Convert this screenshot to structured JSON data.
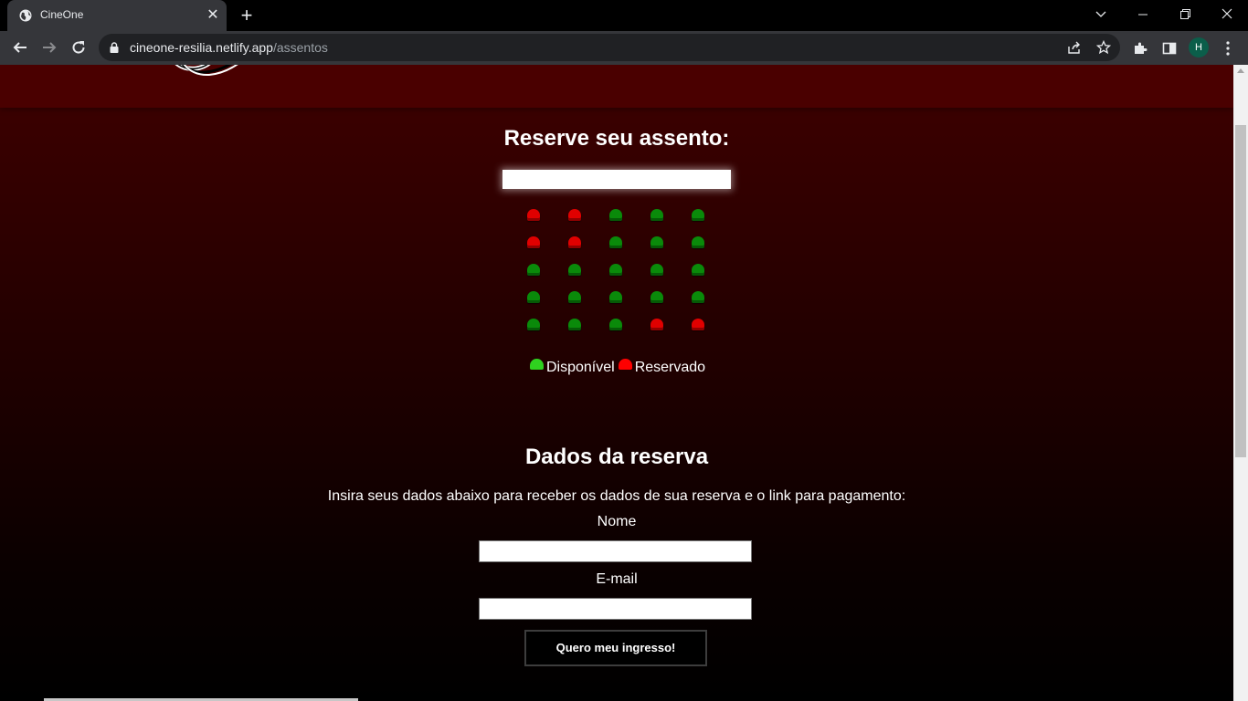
{
  "browser": {
    "tab_title": "CineOne",
    "url_host": "cineone-resilia.netlify.app",
    "url_path": "/assentos",
    "profile_initial": "H",
    "icons": {
      "favicon": "globe-icon",
      "tab_close": "close-icon",
      "new_tab": "plus-icon",
      "back": "arrow-left-icon",
      "forward": "arrow-right-icon",
      "reload": "reload-icon",
      "lock": "lock-icon",
      "share": "share-icon",
      "bookmark": "star-icon",
      "extensions": "puzzle-icon",
      "side_panel": "side-panel-icon",
      "menu": "kebab-menu-icon",
      "tab_search": "chevron-down-icon",
      "minimize": "minimize-icon",
      "restore": "restore-icon",
      "close_window": "close-icon"
    }
  },
  "page": {
    "seat_section": {
      "title": "Reserve seu assento:",
      "seats": [
        [
          "reserved",
          "reserved",
          "available",
          "available",
          "available"
        ],
        [
          "reserved",
          "reserved",
          "available",
          "available",
          "available"
        ],
        [
          "available",
          "available",
          "available",
          "available",
          "available"
        ],
        [
          "available",
          "available",
          "available",
          "available",
          "available"
        ],
        [
          "available",
          "available",
          "available",
          "reserved",
          "reserved"
        ]
      ],
      "legend": {
        "available_label": "Disponível",
        "reserved_label": "Reservado"
      },
      "colors": {
        "available": "#0a8a0a",
        "reserved": "#e00000",
        "legend_available": "#2fd11f",
        "legend_reserved": "#ff0000"
      }
    },
    "booking_section": {
      "title": "Dados da reserva",
      "subtitle": "Insira seus dados abaixo para receber os dados de sua reserva e o link para pagamento:",
      "name_label": "Nome",
      "name_value": "",
      "email_label": "E-mail",
      "email_value": "",
      "submit_label": "Quero meu ingresso!"
    }
  }
}
